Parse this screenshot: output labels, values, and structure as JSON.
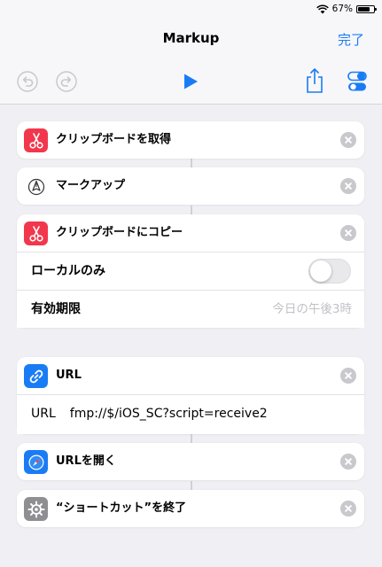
{
  "status": {
    "battery": "67%"
  },
  "nav": {
    "title": "Markup",
    "done": "完了"
  },
  "toolbar": {
    "icons": [
      "undo-icon",
      "redo-icon",
      "play-icon",
      "share-icon",
      "settings-toggle-icon"
    ]
  },
  "actions": [
    {
      "title": "クリップボードを取得",
      "icon": "scissors-icon",
      "icon_bg": "#f2374d"
    },
    {
      "title": "マークアップ",
      "icon": "pen-nib-icon",
      "icon_bg": "#ffffff"
    },
    {
      "title": "クリップボードにコピー",
      "icon": "scissors-icon",
      "icon_bg": "#f2374d",
      "params": [
        {
          "label": "ローカルのみ",
          "type": "toggle",
          "value": false
        },
        {
          "label": "有効期限",
          "type": "text",
          "placeholder": "今日の午後3時"
        }
      ]
    },
    {
      "title": "URL",
      "icon": "link-icon",
      "icon_bg": "#1a7cf5",
      "params": [
        {
          "label": "URL",
          "value": "fmp://$/iOS_SC?script=receive2"
        }
      ]
    },
    {
      "title": "URLを開く",
      "icon": "safari-icon",
      "icon_bg": "#1a7cf5"
    },
    {
      "title": "“ショートカット”を終了",
      "icon": "gear-icon",
      "icon_bg": "#8e8e93"
    }
  ],
  "colors": {
    "accent": "#1a7cf5",
    "background": "#efeff4"
  }
}
